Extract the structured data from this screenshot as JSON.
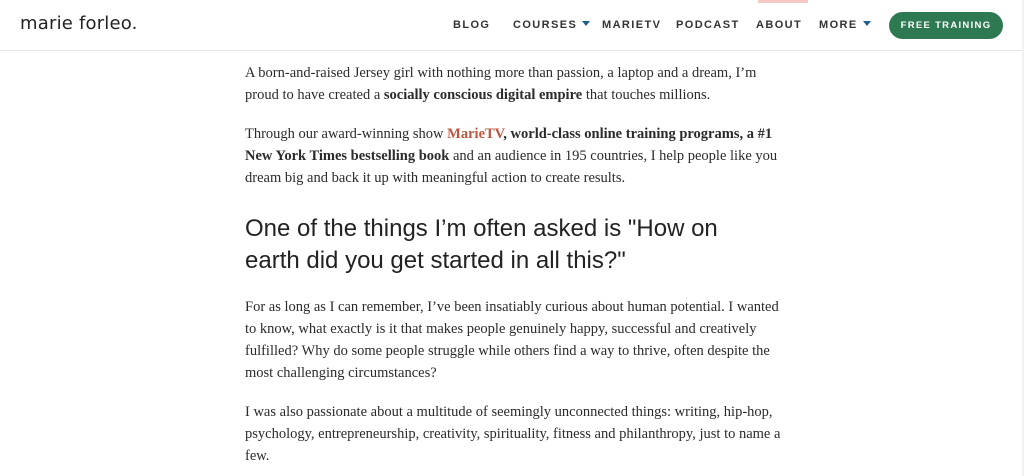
{
  "header": {
    "logo": "marie forleo.",
    "nav": [
      {
        "label": "BLOG"
      },
      {
        "label": "COURSES"
      },
      {
        "label": "MARIETV"
      },
      {
        "label": "PODCAST"
      },
      {
        "label": "ABOUT"
      },
      {
        "label": "MORE"
      }
    ],
    "cta": "FREE TRAINING"
  },
  "article": {
    "p1": {
      "a": "A born-and-raised Jersey girl with nothing more than passion, a laptop and a dream, I’m proud to have created a ",
      "b": "socially conscious digital empire",
      "c": " that touches millions."
    },
    "p2": {
      "a": "Through our award-winning show ",
      "link": "MarieTV",
      "b": ", ",
      "bold": "world-class online training programs, a #1 New York Times bestselling book",
      "c": " and an audience in 195 countries, I help people like you dream big and back it up with meaningful action to create results."
    },
    "heading": "One of the things I’m often asked is \"How on earth did you get started in all this?\"",
    "p3": "For as long as I can remember, I’ve been insatiably curious about human potential. I wanted to know, what exactly is it that makes people genuinely happy, successful and creatively fulfilled? Why do some people struggle while others find a way to thrive, often despite the most challenging circumstances?",
    "p4": "I was also passionate about a multitude of seemingly unconnected things: writing, hip-hop, psychology, entrepreneurship, creativity, spirituality, fitness and philanthropy, just to name a few."
  },
  "colors": {
    "accent_green": "#2d7a52",
    "link_red": "#c0553f",
    "caret_blue": "#1f5d8a"
  }
}
